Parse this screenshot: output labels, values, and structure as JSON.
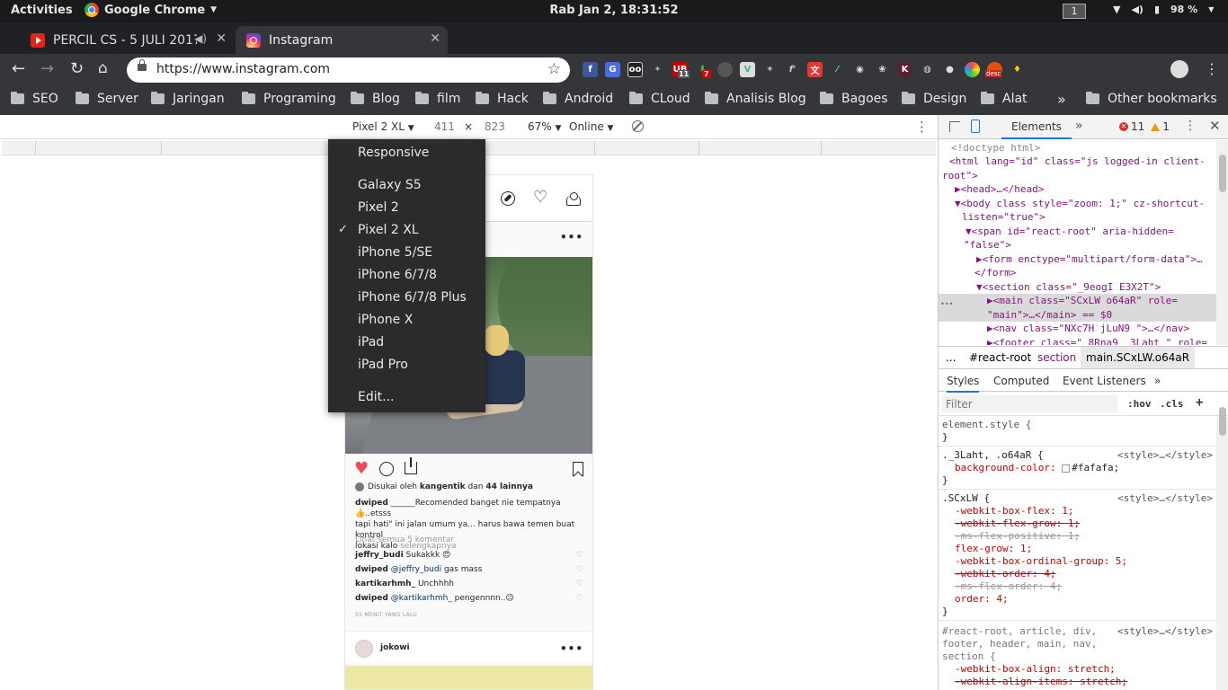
{
  "system": {
    "activities": "Activities",
    "app_name": "Google Chrome",
    "clock": "Rab Jan  2, 18:31:52",
    "workspace": "1",
    "battery": "98 %"
  },
  "tabs": [
    {
      "title": "PERCIL CS - 5 JULI 2017"
    },
    {
      "title": "Instagram"
    }
  ],
  "toolbar": {
    "url": "https://www.instagram.com",
    "ext_badge1": "11",
    "ext_badge2": "7",
    "ext_badge3": "desc"
  },
  "bookmarks": [
    "SEO",
    "Server",
    "Jaringan",
    "Programing",
    "Blog",
    "film",
    "Hack",
    "Android",
    "CLoud",
    "Analisis Blog",
    "Bagoes",
    "Design",
    "Alat"
  ],
  "bookmarks_more": "»",
  "bookmarks_other": "Other bookmarks",
  "device_toolbar": {
    "device": "Pixel 2 XL",
    "width": "411",
    "times": "×",
    "height": "823",
    "zoom": "67%",
    "throttle": "Online"
  },
  "device_menu": {
    "responsive": "Responsive",
    "devices": [
      "Galaxy S5",
      "Pixel 2",
      "Pixel 2 XL",
      "iPhone 5/SE",
      "iPhone 6/7/8",
      "iPhone 6/7/8 Plus",
      "iPhone X",
      "iPad",
      "iPad Pro"
    ],
    "selected": "Pixel 2 XL",
    "edit": "Edit..."
  },
  "post": {
    "liked_by_prefix": "Disukai oleh ",
    "liked_by_user": "kangentik",
    "liked_by_mid": " dan ",
    "liked_by_count": "44 lainnya",
    "caption_user": "dwiped",
    "caption_line1": " ______Recomended banget nie tempatnya 👍..etsss",
    "caption_line2": "tapi hati\" ini jalan umum ya... harus bawa temen buat kontrol",
    "caption_line3": "lokasi kalo ",
    "caption_more": "selengkapnya",
    "view_comments": "Lihat semua 5 komentar",
    "comments": [
      {
        "user": "jeffry_budi",
        "mention": "",
        "text": " Sukakkk 😍"
      },
      {
        "user": "dwiped",
        "mention": " @jeffry_budi",
        "text": " gas mass"
      },
      {
        "user": "kartikarhmh_",
        "mention": "",
        "text": " Unchhhh"
      },
      {
        "user": "dwiped",
        "mention": " @kartikarhmh_",
        "text": " pengennnn..😉"
      }
    ],
    "time": "55 MENIT YANG LALU",
    "next_user": "jokowi"
  },
  "devtools": {
    "tab_elements": "Elements",
    "errors": "11",
    "warnings": "1",
    "dom_lines": [
      "<!doctype html>",
      "<html lang=\"id\" class=\"js logged-in client-",
      "root\">",
      "▶<head>…</head>",
      "▼<body class style=\"zoom: 1;\" cz-shortcut-",
      "listen=\"true\">",
      "▼<span id=\"react-root\" aria-hidden=",
      "\"false\">",
      "▶<form enctype=\"multipart/form-data\">…",
      "</form>",
      "▼<section class=\"_9eogI E3X2T\">",
      "▶<main class=\"SCxLW  o64aR\" role=",
      "\"main\">…</main> == $0",
      "▶<nav class=\"NXc7H jLuN9  \">…</nav>",
      "▶<footer class=\"_8Rna9  _3Laht \" role="
    ],
    "crumbs": [
      "...",
      "#react-root",
      "section",
      "main.SCxLW.o64aR"
    ],
    "style_tabs": [
      "Styles",
      "Computed",
      "Event Listeners",
      "»"
    ],
    "filter_placeholder": "Filter",
    "hov": ":hov",
    "cls": ".cls",
    "plus": "+",
    "rules": [
      {
        "selector": "element.style {",
        "src": ""
      },
      {
        "selector": "}",
        "src": ""
      },
      {
        "selector": "._3Laht, .o64aR {",
        "src": "<style>…</style>"
      },
      {
        "selector": "background-color: ",
        "value": "#fafafa;",
        "src": ""
      },
      {
        "selector": "}",
        "src": ""
      },
      {
        "selector": ".SCxLW {",
        "src": "<style>…</style>"
      },
      {
        "selector": "-webkit-box-flex: 1;",
        "src": ""
      },
      {
        "selector": "-webkit-flex-grow: 1;",
        "src": ""
      },
      {
        "selector": "-ms-flex-positive: 1;",
        "src": ""
      },
      {
        "selector": "flex-grow: 1;",
        "src": ""
      },
      {
        "selector": "-webkit-box-ordinal-group: 5;",
        "src": ""
      },
      {
        "selector": "-webkit-order: 4;",
        "src": ""
      },
      {
        "selector": "-ms-flex-order: 4;",
        "src": ""
      },
      {
        "selector": "order: 4;",
        "src": ""
      },
      {
        "selector": "}",
        "src": ""
      },
      {
        "selector": "#react-root, article, div,",
        "src": "<style>…</style>"
      },
      {
        "selector": "footer, header, main, nav,",
        "src": ""
      },
      {
        "selector": "section {",
        "src": ""
      },
      {
        "selector": "-webkit-box-align: stretch;",
        "src": ""
      },
      {
        "selector": "-webkit-align-items: stretch;",
        "src": ""
      }
    ]
  }
}
